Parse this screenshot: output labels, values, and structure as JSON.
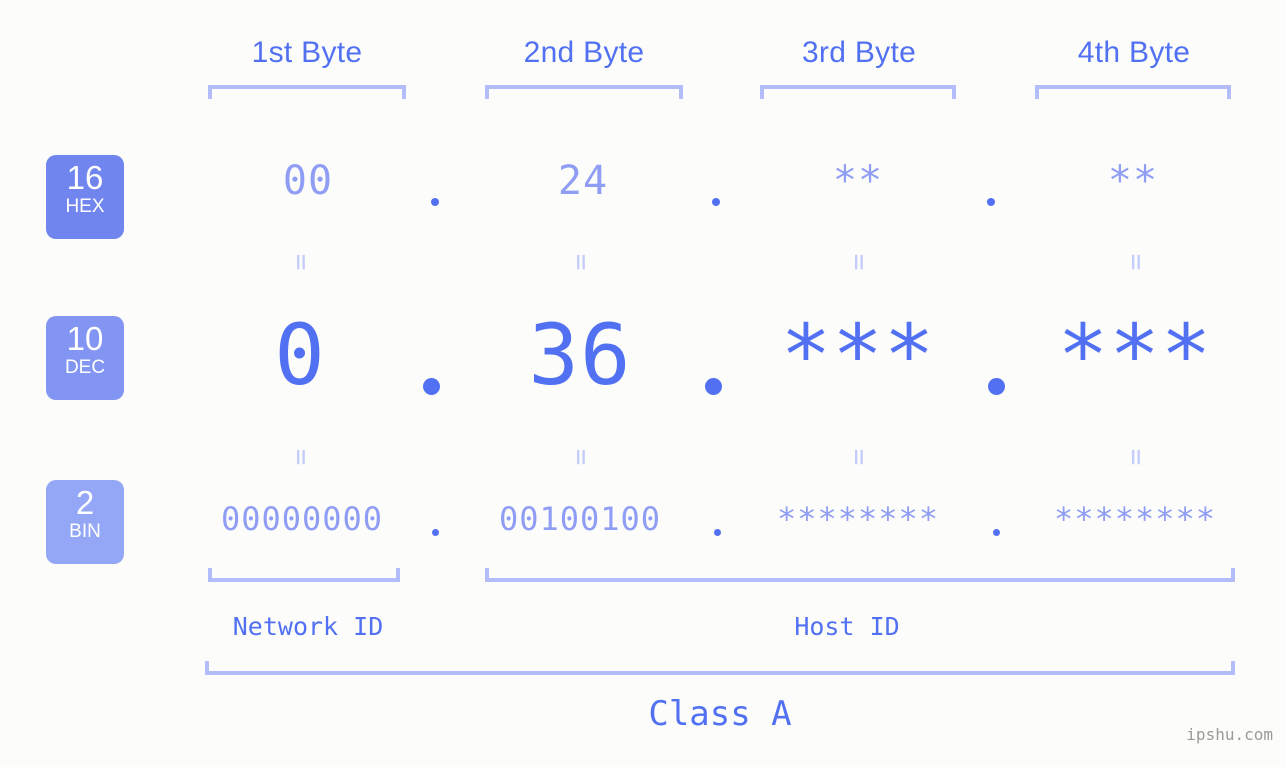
{
  "background": "#fcfdfa",
  "colors": {
    "accent_strong": "#5271f2",
    "accent_mid": "#8f9df4",
    "accent_light": "#b4bdfb",
    "equals": "#c5cbfa",
    "watermark": "#9a9a9a",
    "badge_hex": "#7086ee",
    "badge_dec": "#8395f2",
    "badge_bin": "#93a7f6"
  },
  "header": {
    "byte_labels": [
      "1st Byte",
      "2nd Byte",
      "3rd Byte",
      "4th Byte"
    ]
  },
  "bases": [
    {
      "number": "16",
      "name": "HEX"
    },
    {
      "number": "10",
      "name": "DEC"
    },
    {
      "number": "2",
      "name": "BIN"
    }
  ],
  "rows": {
    "hex": {
      "values": [
        "00",
        "24",
        "**",
        "**"
      ],
      "separators": [
        ".",
        ".",
        "."
      ]
    },
    "dec": {
      "values": [
        "0",
        "36",
        "***",
        "***"
      ],
      "separators": [
        ".",
        ".",
        "."
      ]
    },
    "bin": {
      "values": [
        "00000000",
        "00100100",
        "********",
        "********"
      ],
      "separators": [
        ".",
        ".",
        "."
      ]
    }
  },
  "equals_glyph": "=",
  "footer": {
    "network_id_label": "Network ID",
    "host_id_label": "Host ID",
    "class_label": "Class A"
  },
  "watermark": "ipshu.com"
}
